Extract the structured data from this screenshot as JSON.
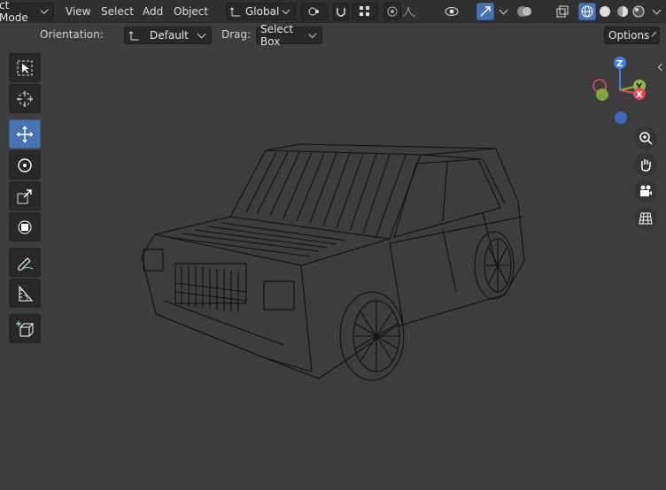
{
  "header": {
    "mode_label": "ct Mode",
    "menus": [
      "View",
      "Select",
      "Add",
      "Object"
    ],
    "transform_orientation": "Global"
  },
  "tool_settings": {
    "orientation_label": "Orientation:",
    "orientation_value": "Default",
    "drag_label": "Drag:",
    "drag_value": "Select Box",
    "options_label": "Options"
  },
  "gizmo": {
    "z_label": "Z",
    "y_label": "Y",
    "x_label": "X",
    "colors": {
      "x": "#e64b5a",
      "y": "#8cbf38",
      "z": "#3e7ff0"
    }
  },
  "toolbar": {
    "tools": [
      "select-box",
      "cursor",
      "move",
      "rotate",
      "scale",
      "transform",
      "annotate",
      "measure",
      "add-cube"
    ],
    "active_tool": "move"
  },
  "colors": {
    "accent": "#4772b3",
    "header_bg": "#303030",
    "viewport_bg": "#3d3d3d"
  }
}
